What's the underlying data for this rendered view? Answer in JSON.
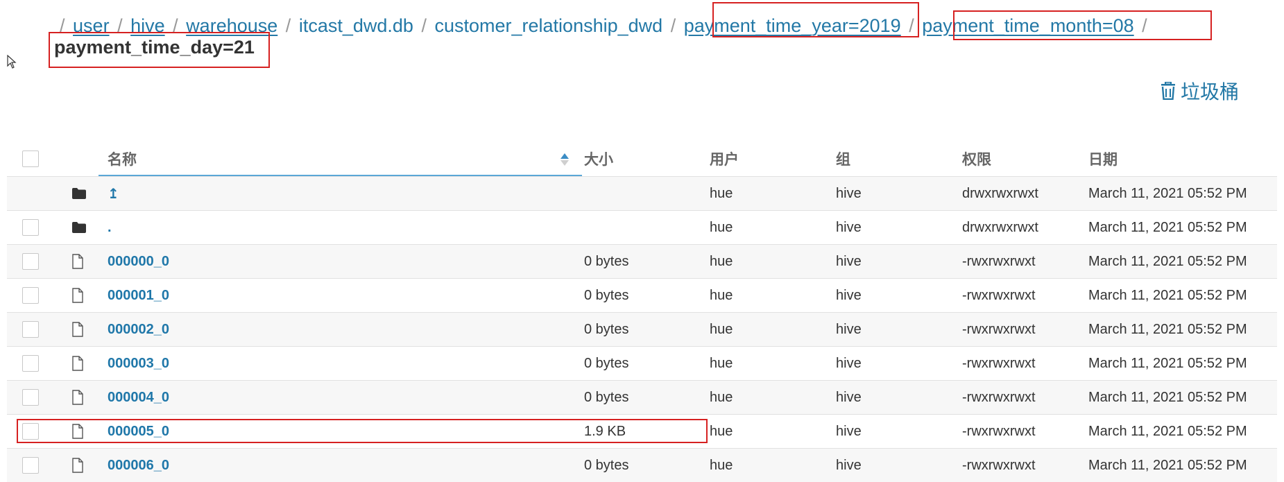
{
  "breadcrumb": {
    "segments": [
      "user",
      "hive",
      "warehouse",
      "itcast_dwd.db",
      "customer_relationship_dwd",
      "payment_time_year=2019",
      "payment_time_month=08"
    ],
    "separator": "/",
    "current": "payment_time_day=21"
  },
  "toolbar": {
    "trash_label": "垃圾桶"
  },
  "table": {
    "headers": {
      "name": "名称",
      "size": "大小",
      "user": "用户",
      "group": "组",
      "permissions": "权限",
      "date": "日期"
    },
    "rows": [
      {
        "icon": "folder-icon",
        "name": "↥",
        "size": "",
        "user": "hue",
        "group": "hive",
        "permissions": "drwxrwxrwxt",
        "date": "March 11, 2021 05:52 PM"
      },
      {
        "icon": "folder-icon",
        "name": ".",
        "size": "",
        "user": "hue",
        "group": "hive",
        "permissions": "drwxrwxrwxt",
        "date": "March 11, 2021 05:52 PM"
      },
      {
        "icon": "file-icon",
        "name": "000000_0",
        "size": "0 bytes",
        "user": "hue",
        "group": "hive",
        "permissions": "-rwxrwxrwxt",
        "date": "March 11, 2021 05:52 PM"
      },
      {
        "icon": "file-icon",
        "name": "000001_0",
        "size": "0 bytes",
        "user": "hue",
        "group": "hive",
        "permissions": "-rwxrwxrwxt",
        "date": "March 11, 2021 05:52 PM"
      },
      {
        "icon": "file-icon",
        "name": "000002_0",
        "size": "0 bytes",
        "user": "hue",
        "group": "hive",
        "permissions": "-rwxrwxrwxt",
        "date": "March 11, 2021 05:52 PM"
      },
      {
        "icon": "file-icon",
        "name": "000003_0",
        "size": "0 bytes",
        "user": "hue",
        "group": "hive",
        "permissions": "-rwxrwxrwxt",
        "date": "March 11, 2021 05:52 PM"
      },
      {
        "icon": "file-icon",
        "name": "000004_0",
        "size": "0 bytes",
        "user": "hue",
        "group": "hive",
        "permissions": "-rwxrwxrwxt",
        "date": "March 11, 2021 05:52 PM"
      },
      {
        "icon": "file-icon",
        "name": "000005_0",
        "size": "1.9 KB",
        "user": "hue",
        "group": "hive",
        "permissions": "-rwxrwxrwxt",
        "date": "March 11, 2021 05:52 PM"
      },
      {
        "icon": "file-icon",
        "name": "000006_0",
        "size": "0 bytes",
        "user": "hue",
        "group": "hive",
        "permissions": "-rwxrwxrwxt",
        "date": "March 11, 2021 05:52 PM"
      }
    ]
  },
  "colors": {
    "link": "#1f77a9",
    "annotation": "#d62121",
    "row_alt": "#f7f7f7"
  }
}
